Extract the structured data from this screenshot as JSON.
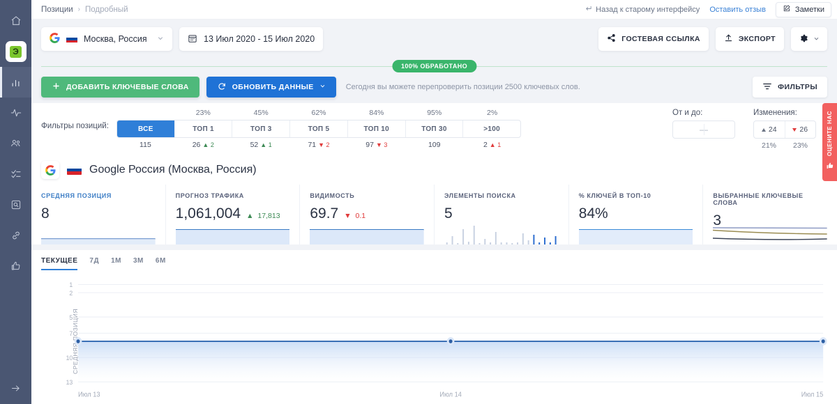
{
  "sidebar": {
    "items": [
      {
        "name": "home",
        "icon": "home-icon"
      },
      {
        "name": "project",
        "icon": "project-logo",
        "badge": "Э"
      },
      {
        "name": "rankings",
        "icon": "bar-chart-icon",
        "active": true
      },
      {
        "name": "activity",
        "icon": "pulse-icon"
      },
      {
        "name": "competitors",
        "icon": "people-icon"
      },
      {
        "name": "tasks",
        "icon": "checklist-icon"
      },
      {
        "name": "audit",
        "icon": "search-box-icon"
      },
      {
        "name": "backlinks",
        "icon": "link-icon"
      },
      {
        "name": "feedback",
        "icon": "thumbs-up-icon"
      }
    ],
    "expand_icon": "arrow-right-icon"
  },
  "topbar": {
    "breadcrumb": {
      "root": "Позиции",
      "separator": "›",
      "current": "Подробный"
    },
    "back_link": "Назад к старому интерфейсу",
    "back_icon": "return-arrow-icon",
    "feedback_link": "Оставить отзыв",
    "notes_button": "Заметки",
    "notes_icon": "pencil-square-icon"
  },
  "controls": {
    "site_selector": {
      "value": "Москва, Россия",
      "engine_icon": "google-icon",
      "flag_icon": "russia-flag-icon",
      "chevron": "chevron-down-icon"
    },
    "date_range": {
      "value": "13 Июл 2020 - 15 Июл 2020",
      "icon": "calendar-icon"
    },
    "guest_link_button": "ГОСТЕВАЯ ССЫЛКА",
    "guest_link_icon": "share-icon",
    "export_button": "ЭКСПОРТ",
    "export_icon": "upload-icon",
    "settings_icon": "gear-icon",
    "settings_chevron": "chevron-down-icon",
    "progress_badge": "100% ОБРАБОТАНО",
    "add_keywords_button": "ДОБАВИТЬ КЛЮЧЕВЫЕ СЛОВА",
    "add_keywords_icon": "plus-icon",
    "refresh_button": "ОБНОВИТЬ ДАННЫЕ",
    "refresh_icon": "refresh-icon",
    "refresh_chevron": "chevron-down-icon",
    "hint": "Сегодня вы можете перепроверить позиции 2500 ключевых слов.",
    "filters_button": "ФИЛЬТРЫ",
    "filters_icon": "filter-icon"
  },
  "position_filters": {
    "label": "Фильтры позиций:",
    "segments": [
      {
        "label": "ВСЕ",
        "percent": "",
        "count": "115",
        "delta": "",
        "dir": "none",
        "active": true
      },
      {
        "label": "ТОП 1",
        "percent": "23%",
        "count": "26",
        "delta": "2",
        "dir": "up"
      },
      {
        "label": "ТОП 3",
        "percent": "45%",
        "count": "52",
        "delta": "1",
        "dir": "up"
      },
      {
        "label": "ТОП 5",
        "percent": "62%",
        "count": "71",
        "delta": "2",
        "dir": "down"
      },
      {
        "label": "ТОП 10",
        "percent": "84%",
        "count": "97",
        "delta": "3",
        "dir": "down"
      },
      {
        "label": "ТОП 30",
        "percent": "95%",
        "count": "109",
        "delta": "",
        "dir": "none"
      },
      {
        "label": ">100",
        "percent": "2%",
        "count": "2",
        "delta": "1",
        "dir": "up-red"
      }
    ],
    "range": {
      "title": "От и до:",
      "value": "—"
    },
    "changes": {
      "title": "Изменения:",
      "up_count": "24",
      "down_count": "26",
      "up_percent": "21%",
      "down_percent": "23%"
    }
  },
  "rate_tab": {
    "label": "ОЦЕНИТЕ НАС",
    "icon": "thumbs-up-icon"
  },
  "engine": {
    "title": "Google Россия (Москва, Россия)",
    "icon": "google-icon",
    "flag_icon": "russia-flag-icon"
  },
  "cards": [
    {
      "title": "СРЕДНЯЯ ПОЗИЦИЯ",
      "value": "8",
      "delta": "",
      "dir": "none",
      "spark": "flat-line",
      "highlight": true
    },
    {
      "title": "ПРОГНОЗ ТРАФИКА",
      "value": "1,061,004",
      "delta": "17,813",
      "dir": "up",
      "spark": "flat-area"
    },
    {
      "title": "ВИДИМОСТЬ",
      "value": "69.7",
      "delta": "0.1",
      "dir": "down",
      "spark": "flat-area"
    },
    {
      "title": "ЭЛЕМЕНТЫ ПОИСКА",
      "value": "5",
      "delta": "",
      "dir": "none",
      "spark": "bars"
    },
    {
      "title": "% КЛЮЧЕЙ В ТОП-10",
      "value": "84%",
      "delta": "",
      "dir": "none",
      "spark": "flat-area"
    },
    {
      "title": "ВЫБРАННЫЕ КЛЮЧЕВЫЕ СЛОВА",
      "value": "3",
      "delta": "",
      "dir": "none",
      "spark": "multi-line"
    }
  ],
  "chart_tabs": [
    {
      "label": "ТЕКУЩЕЕ",
      "active": true
    },
    {
      "label": "7Д",
      "active": false
    },
    {
      "label": "1М",
      "active": false
    },
    {
      "label": "3М",
      "active": false
    },
    {
      "label": "6М",
      "active": false
    }
  ],
  "chart_data": {
    "type": "line",
    "title": "",
    "ylabel": "СРЕДНЯЯ ПОЗИЦИЯ",
    "xlabel": "",
    "categories": [
      "Июл 13",
      "Июл 14",
      "Июл 15"
    ],
    "tick_labels_y": [
      "1",
      "2",
      "5",
      "7",
      "10",
      "13"
    ],
    "ylim": [
      1,
      13
    ],
    "yaxis_inverted": true,
    "grid": true,
    "legend": "none",
    "series": [
      {
        "name": "Средняя позиция",
        "values": [
          8,
          8,
          8
        ],
        "color": "#3a6fb5",
        "fill": "#dbe7f8",
        "markers": true
      }
    ]
  },
  "colors": {
    "accent_blue": "#2f7fd8",
    "green": "#4fb97b",
    "red": "#e03b3b",
    "rail": "#4a5672",
    "rate_tab": "#f2605f",
    "page_bg": "#f1f3f7"
  },
  "sparkline_bars": [
    3,
    12,
    2,
    22,
    4,
    27,
    2,
    8,
    3,
    18,
    3,
    3,
    2,
    3,
    16,
    6,
    14,
    3,
    10,
    3,
    12
  ]
}
